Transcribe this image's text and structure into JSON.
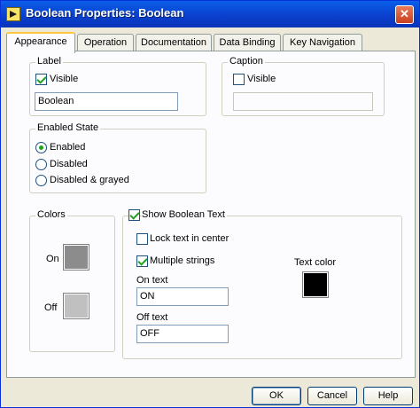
{
  "window": {
    "title": "Boolean Properties: Boolean"
  },
  "tabs": [
    {
      "label": "Appearance"
    },
    {
      "label": "Operation"
    },
    {
      "label": "Documentation"
    },
    {
      "label": "Data Binding"
    },
    {
      "label": "Key Navigation"
    }
  ],
  "label_group": {
    "title": "Label",
    "visible_label": "Visible",
    "visible_checked": true,
    "value": "Boolean"
  },
  "caption_group": {
    "title": "Caption",
    "visible_label": "Visible",
    "visible_checked": false,
    "value": ""
  },
  "enabled_state": {
    "title": "Enabled State",
    "options": [
      "Enabled",
      "Disabled",
      "Disabled & grayed"
    ],
    "selected": "Enabled"
  },
  "colors_group": {
    "title": "Colors",
    "on_label": "On",
    "off_label": "Off",
    "on_color": "#8c8c8c",
    "off_color": "#c0c0c0"
  },
  "boolean_text": {
    "title": "Show Boolean Text",
    "checked": true,
    "lock_center_label": "Lock text in center",
    "lock_center_checked": false,
    "multiple_strings_label": "Multiple strings",
    "multiple_strings_checked": true,
    "on_text_label": "On text",
    "on_text_value": "ON",
    "off_text_label": "Off text",
    "off_text_value": "OFF",
    "text_color_label": "Text color",
    "text_color": "#000000"
  },
  "buttons": {
    "ok": "OK",
    "cancel": "Cancel",
    "help": "Help"
  }
}
